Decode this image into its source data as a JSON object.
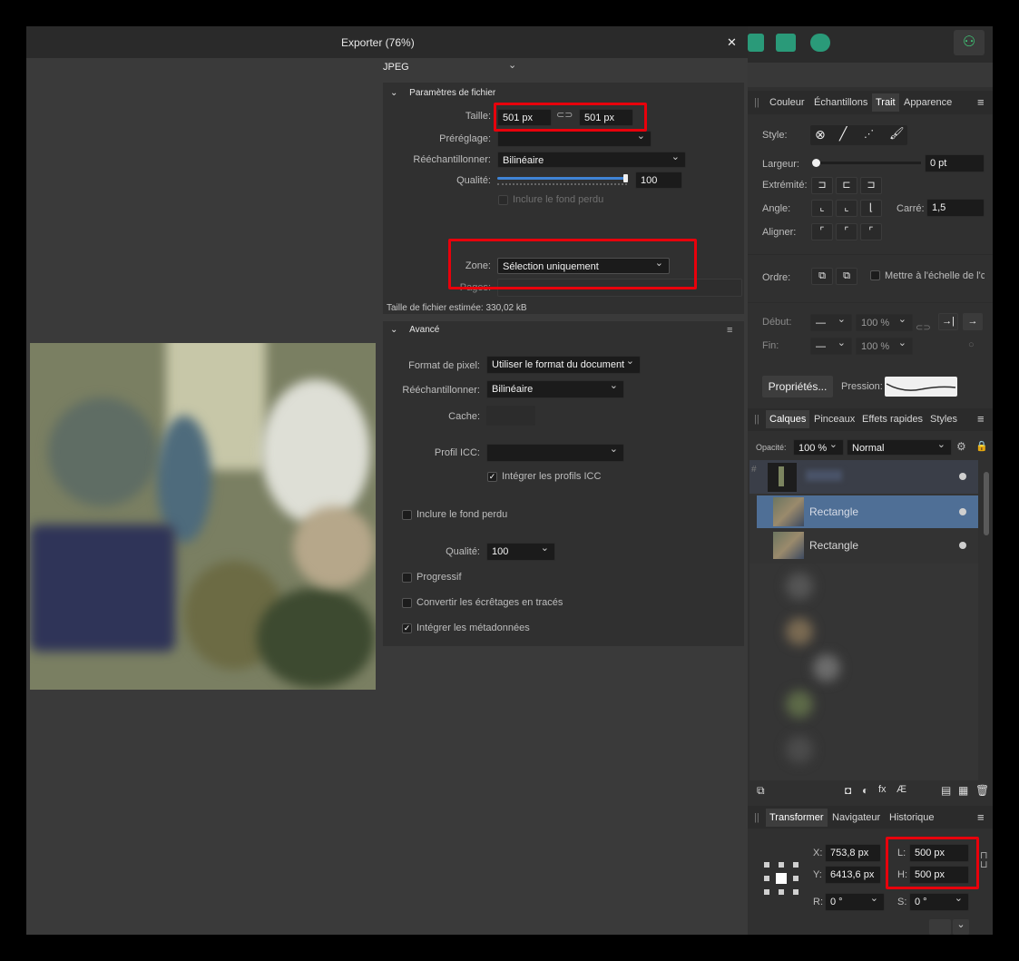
{
  "dialog": {
    "title": "Exporter (76%)",
    "close": "✕",
    "format": "JPEG",
    "file_section": "Paramètres de fichier",
    "size_label": "Taille:",
    "width": "501 px",
    "height": "501 px",
    "preset_label": "Préréglage:",
    "resample_label": "Rééchantillonner:",
    "resample_value": "Bilinéaire",
    "quality_label": "Qualité:",
    "quality_value": "100",
    "bleed_label": "Inclure le fond perdu",
    "zone_label": "Zone:",
    "zone_value": "Sélection uniquement",
    "pages_label": "Pages:",
    "estimate": "Taille de fichier estimée: 330,02 kB",
    "advanced_section": "Avancé",
    "pixel_format_label": "Format de pixel:",
    "pixel_format_value": "Utiliser le format du document",
    "adv_resample_label": "Rééchantillonner:",
    "adv_resample_value": "Bilinéaire",
    "cache_label": "Cache:",
    "icc_label": "Profil ICC:",
    "embed_icc": "Intégrer les profils ICC",
    "adv_bleed": "Inclure le fond perdu",
    "adv_quality_label": "Qualité:",
    "adv_quality_value": "100",
    "progressive": "Progressif",
    "convert_clips": "Convertir les écrêtages en tracés",
    "embed_meta": "Intégrer les métadonnées"
  },
  "stroke_panel": {
    "tabs": [
      "Couleur",
      "Échantillons",
      "Trait",
      "Apparence"
    ],
    "style_label": "Style:",
    "width_label": "Largeur:",
    "width_value": "0 pt",
    "cap_label": "Extrémité:",
    "join_label": "Angle:",
    "miter_label": "Carré:",
    "miter_value": "1,5",
    "align_label": "Aligner:",
    "order_label": "Ordre:",
    "scale_label": "Mettre à l'échelle de l'c",
    "start_label": "Début:",
    "end_label": "Fin:",
    "start_pct": "100 %",
    "end_pct": "100 %",
    "props_button": "Propriétés...",
    "pressure_label": "Pression:"
  },
  "layers_panel": {
    "tabs": [
      "Calques",
      "Pinceaux",
      "Effets rapides",
      "Styles"
    ],
    "opacity_label": "Opacité:",
    "opacity_value": "100 %",
    "blend_mode": "Normal",
    "layers": [
      "Rectangle",
      "Rectangle"
    ]
  },
  "transform_panel": {
    "tabs": [
      "Transformer",
      "Navigateur",
      "Historique"
    ],
    "x_label": "X:",
    "x_value": "753,8 px",
    "y_label": "Y:",
    "y_value": "6413,6 px",
    "w_label": "L:",
    "w_value": "500 px",
    "h_label": "H:",
    "h_value": "500 px",
    "r_label": "R:",
    "r_value": "0 °",
    "s_label": "S:",
    "s_value": "0 °"
  },
  "colors": {
    "accent": "#4f6f96",
    "highlight": "#e8000b",
    "user_icon": "#3fd07a"
  }
}
